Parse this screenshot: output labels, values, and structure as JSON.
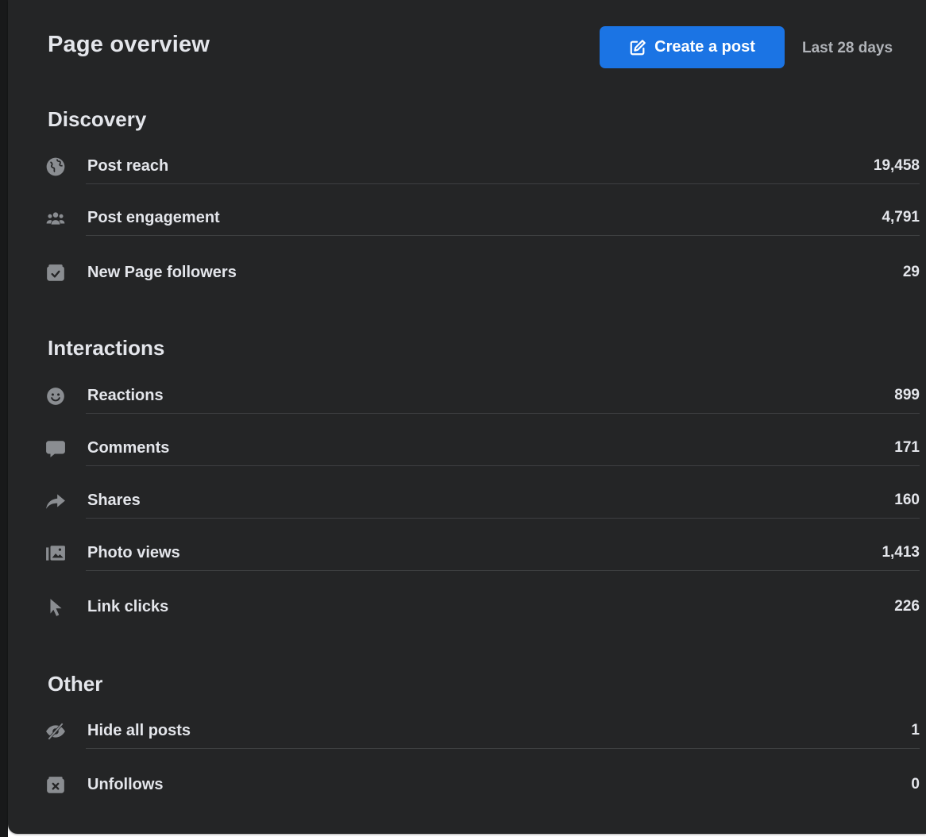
{
  "header": {
    "title": "Page overview",
    "create_post_label": "Create a post",
    "date_range": "Last 28 days"
  },
  "colors": {
    "primary": "#1b74e4",
    "card_bg": "#242526",
    "text": "#e4e6eb",
    "muted": "#b0b3b8",
    "icon": "#8a8d91"
  },
  "sections": {
    "discovery": {
      "title": "Discovery",
      "rows": [
        {
          "icon": "globe-icon",
          "label": "Post reach",
          "value": "19,458"
        },
        {
          "icon": "people-icon",
          "label": "Post engagement",
          "value": "4,791"
        },
        {
          "icon": "follow-inbox-icon",
          "label": "New Page followers",
          "value": "29"
        }
      ]
    },
    "interactions": {
      "title": "Interactions",
      "rows": [
        {
          "icon": "smiley-icon",
          "label": "Reactions",
          "value": "899"
        },
        {
          "icon": "comment-icon",
          "label": "Comments",
          "value": "171"
        },
        {
          "icon": "share-icon",
          "label": "Shares",
          "value": "160"
        },
        {
          "icon": "photo-icon",
          "label": "Photo views",
          "value": "1,413"
        },
        {
          "icon": "cursor-icon",
          "label": "Link clicks",
          "value": "226"
        }
      ]
    },
    "other": {
      "title": "Other",
      "rows": [
        {
          "icon": "eye-off-icon",
          "label": "Hide all posts",
          "value": "1"
        },
        {
          "icon": "unfollow-inbox-icon",
          "label": "Unfollows",
          "value": "0"
        }
      ]
    }
  }
}
